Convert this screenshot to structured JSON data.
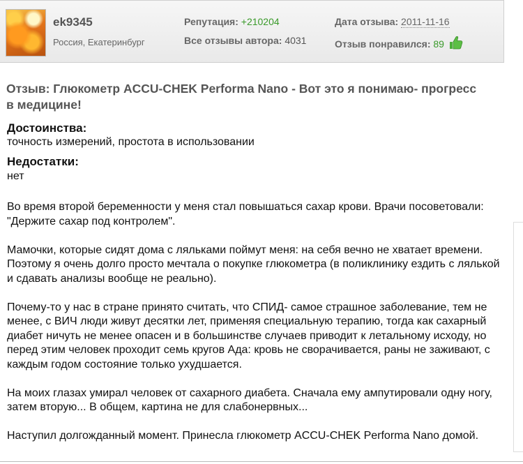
{
  "author": {
    "username": "ek9345",
    "location": "Россия, Екатеринбург",
    "reputation_label": "Репутация:",
    "reputation_value": "+210204",
    "reviews_label": "Все отзывы автора:",
    "reviews_value": "4031",
    "date_label": "Дата отзыва:",
    "date_value": "2011-11-16",
    "liked_label": "Отзыв понравился:",
    "liked_value": "89",
    "thumb_icon": "thumbs-up-icon",
    "accent_color": "#3a9a2a"
  },
  "review": {
    "title": "Отзыв: Глюкометр ACCU-CHEK Performa Nano - Вот это я понимаю- прогресс в медицине!",
    "pros_label": "Достоинства:",
    "pros": "точность измерений, простота в использовании",
    "cons_label": "Недостатки:",
    "cons": "нет",
    "paragraphs": [
      "Во время второй беременности у меня стал повышаться сахар крови. Врачи посоветовали: \"Держите сахар под контролем\".",
      "Мамочки, которые сидят дома с ляльками поймут меня: на себя вечно не хватает времени. Поэтому я очень долго просто мечтала о покупке глюкометра (в поликлинику ездить с лялькой и сдавать анализы вообще не реально).",
      "Почему-то у нас в стране принято считать, что СПИД- самое страшное заболевание, тем не менее, с ВИЧ люди живут десятки лет, применяя специальную терапию, тогда как сахарный диабет ничуть не менее опасен и в большинстве случаев приводит к летальному исходу, но перед этим человек проходит семь кругов Ада: кровь не сворачивается, раны не заживают, с каждым годом состояние только ухудшается.",
      "На моих глазах умирал человек от сахарного диабета. Сначала ему ампутировали одну ногу, затем вторую... В общем, картина не для слабонервных...",
      "Наступил долгожданный момент. Принесла глюкометр ACCU-CHEK Performa Nano домой."
    ]
  }
}
